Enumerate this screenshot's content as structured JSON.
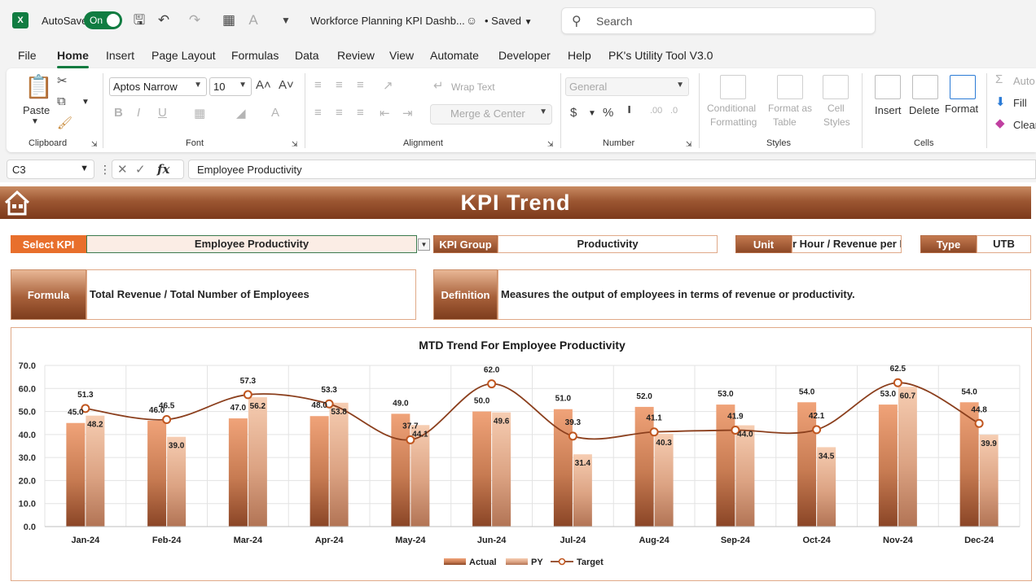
{
  "titlebar": {
    "app_icon": "X",
    "autosave_label": "AutoSave",
    "autosave_state": "On",
    "doc_title": "Workforce Planning KPI Dashb...",
    "saved_status": "• Saved",
    "search_placeholder": "Search"
  },
  "menu": {
    "tabs": [
      "File",
      "Home",
      "Insert",
      "Page Layout",
      "Formulas",
      "Data",
      "Review",
      "View",
      "Automate",
      "Developer",
      "Help",
      "PK's Utility Tool V3.0"
    ],
    "active": "Home"
  },
  "ribbon": {
    "clipboard": {
      "paste": "Paste",
      "label": "Clipboard"
    },
    "font": {
      "name": "Aptos Narrow",
      "size": "10",
      "label": "Font"
    },
    "alignment": {
      "wrap": "Wrap Text",
      "merge": "Merge & Center",
      "label": "Alignment"
    },
    "number": {
      "format": "General",
      "label": "Number"
    },
    "styles": {
      "cond1": "Conditional",
      "cond2": "Formatting",
      "fmt1": "Format as",
      "fmt2": "Table",
      "cell1": "Cell",
      "cell2": "Styles",
      "label": "Styles"
    },
    "cells": {
      "insert": "Insert",
      "delete": "Delete",
      "format": "Format",
      "label": "Cells"
    },
    "editing": {
      "autosum": "Auto",
      "fill": "Fill",
      "clear": "Clear"
    }
  },
  "formula_bar": {
    "cell_ref": "C3",
    "fx": "fx",
    "content": "Employee Productivity"
  },
  "dashboard": {
    "title": "KPI Trend",
    "select_kpi_label": "Select KPI",
    "select_kpi_value": "Employee Productivity",
    "kpi_group_label": "KPI Group",
    "kpi_group_value": "Productivity",
    "unit_label": "Unit",
    "unit_value": "r Hour / Revenue per E",
    "type_label": "Type",
    "type_value": "UTB",
    "formula_label": "Formula",
    "formula_value": "Total Revenue / Total Number of Employees",
    "definition_label": "Definition",
    "definition_value": "Measures the output of employees in terms of revenue or productivity."
  },
  "colors": {
    "excel_green": "#107c41",
    "actual_bar": "#e3956a",
    "py_bar": "#f0c1a3",
    "target_line": "#8b3f1d",
    "banner_dark": "#7c3a1c",
    "select_kpi_orange": "#e86f2c"
  },
  "chart_data": {
    "type": "bar",
    "title": "MTD Trend For Employee Productivity",
    "categories": [
      "Jan-24",
      "Feb-24",
      "Mar-24",
      "Apr-24",
      "May-24",
      "Jun-24",
      "Jul-24",
      "Aug-24",
      "Sep-24",
      "Oct-24",
      "Nov-24",
      "Dec-24"
    ],
    "series": [
      {
        "name": "Actual",
        "kind": "bar",
        "values": [
          45.0,
          46.0,
          47.0,
          48.0,
          49.0,
          50.0,
          51.0,
          52.0,
          53.0,
          54.0,
          53.0,
          54.0
        ]
      },
      {
        "name": "PY",
        "kind": "bar",
        "values": [
          48.2,
          39.0,
          56.2,
          53.8,
          44.1,
          49.6,
          31.4,
          40.3,
          44.0,
          34.5,
          60.7,
          39.9
        ]
      },
      {
        "name": "Target",
        "kind": "line",
        "values": [
          51.3,
          46.5,
          57.3,
          53.3,
          37.7,
          62.0,
          39.3,
          41.1,
          41.9,
          42.1,
          62.5,
          44.8
        ]
      }
    ],
    "ylim": [
      0,
      70
    ],
    "yticks": [
      "0.0",
      "10.0",
      "20.0",
      "30.0",
      "40.0",
      "50.0",
      "60.0",
      "70.0"
    ],
    "grid": true,
    "legend": "bottom-center"
  }
}
